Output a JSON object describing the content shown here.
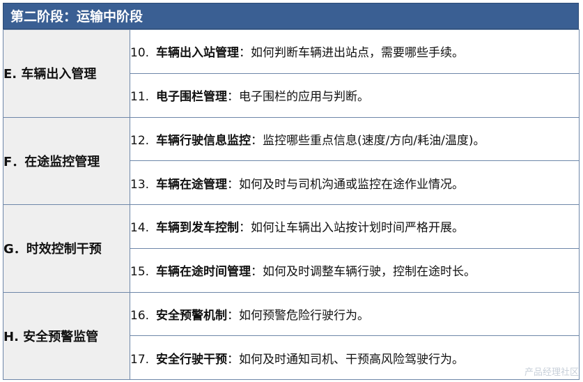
{
  "header": {
    "title": "第二阶段：运输中阶段"
  },
  "groups": [
    {
      "label": "E.  车辆出入管理",
      "items": [
        {
          "num": "10.",
          "title": "车辆出入站管理",
          "desc": "：如何判断车辆进出站点，需要哪些手续。"
        },
        {
          "num": "11.",
          "title": "电子围栏管理",
          "desc": "：电子围栏的应用与判断。"
        }
      ]
    },
    {
      "label": "F．在途监控管理",
      "items": [
        {
          "num": "12.",
          "title": "车辆行驶信息监控",
          "desc": "：监控哪些重点信息(速度/方向/耗油/温度)。"
        },
        {
          "num": "13.",
          "title": "车辆在途管理",
          "desc": "：如何及时与司机沟通或监控在途作业情况。"
        }
      ]
    },
    {
      "label": "G．时效控制干预",
      "items": [
        {
          "num": "14.",
          "title": "车辆到发车控制",
          "desc": "：如何让车辆出入站按计划时间严格开展。"
        },
        {
          "num": "15.",
          "title": "车辆在途时间管理",
          "desc": "：如何及时调整车辆行驶，控制在途时长。"
        }
      ]
    },
    {
      "label": "H.  安全预警监管",
      "items": [
        {
          "num": "16.",
          "title": "安全预警机制",
          "desc": "：如何预警危险行驶行为。"
        },
        {
          "num": "17.",
          "title": "安全行驶干预",
          "desc": "：如何及时通知司机、干预高风险驾驶行为。"
        }
      ]
    }
  ],
  "watermark": "产品经理社区"
}
